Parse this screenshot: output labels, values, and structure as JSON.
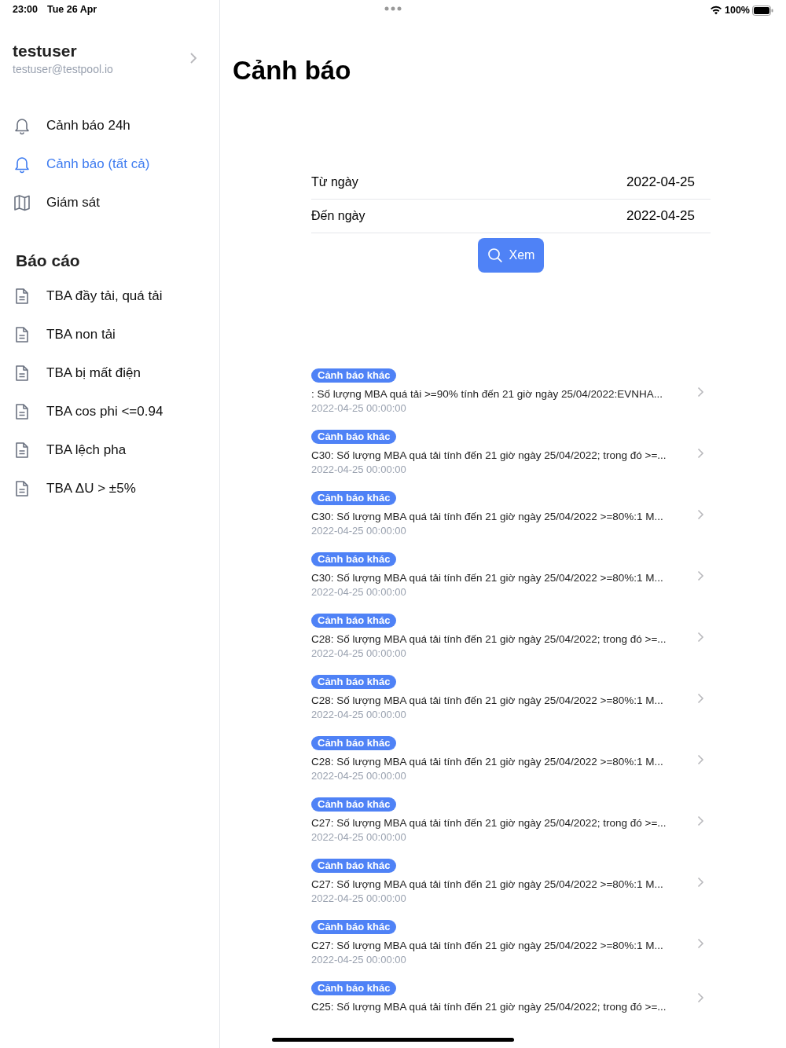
{
  "status_bar": {
    "time": "23:00",
    "date": "Tue 26 Apr",
    "battery": "100%"
  },
  "sidebar": {
    "user": {
      "name": "testuser",
      "email": "testuser@testpool.io"
    },
    "items": [
      {
        "kind": "bell",
        "label": "Cảnh báo 24h",
        "selected": false
      },
      {
        "kind": "bell",
        "label": "Cảnh báo (tất cả)",
        "selected": true
      },
      {
        "kind": "map",
        "label": "Giám sát",
        "selected": false
      }
    ],
    "reports": {
      "title": "Báo cáo",
      "items": [
        {
          "kind": "doc",
          "label": "TBA đầy tải, quá tải",
          "selected": false
        },
        {
          "kind": "doc",
          "label": "TBA non tải",
          "selected": false
        },
        {
          "kind": "doc",
          "label": "TBA bị mất điện",
          "selected": false
        },
        {
          "kind": "doc",
          "label": "TBA cos phi <=0.94",
          "selected": false
        },
        {
          "kind": "doc",
          "label": "TBA lệch pha",
          "selected": false
        },
        {
          "kind": "doc",
          "label": "TBA ΔU > ±5%",
          "selected": false
        }
      ]
    }
  },
  "title": "Cảnh báo",
  "filters": [
    {
      "label": "Từ ngày",
      "value": "2022-04-25"
    },
    {
      "label": "Đến ngày",
      "value": "2022-04-25"
    }
  ],
  "search_button": "Xem",
  "alerts": [
    {
      "tag": "Cảnh báo khác",
      "text": ": Số lượng MBA quá tải >=90% tính đến 21 giờ ngày 25/04/2022:EVNHA...",
      "time": "2022-04-25 00:00:00"
    },
    {
      "tag": "Cảnh báo khác",
      "text": "C30: Số lượng MBA quá tải tính đến 21 giờ ngày 25/04/2022; trong đó >=...",
      "time": "2022-04-25 00:00:00"
    },
    {
      "tag": "Cảnh báo khác",
      "text": "C30: Số lượng MBA quá tải tính đến 21 giờ ngày 25/04/2022 >=80%:1 M...",
      "time": "2022-04-25 00:00:00"
    },
    {
      "tag": "Cảnh báo khác",
      "text": "C30: Số lượng MBA quá tải tính đến 21 giờ ngày 25/04/2022 >=80%:1 M...",
      "time": "2022-04-25 00:00:00"
    },
    {
      "tag": "Cảnh báo khác",
      "text": "C28: Số lượng MBA quá tải tính đến 21 giờ ngày 25/04/2022; trong đó >=...",
      "time": "2022-04-25 00:00:00"
    },
    {
      "tag": "Cảnh báo khác",
      "text": "C28: Số lượng MBA quá tải tính đến 21 giờ ngày 25/04/2022 >=80%:1 M...",
      "time": "2022-04-25 00:00:00"
    },
    {
      "tag": "Cảnh báo khác",
      "text": "C28: Số lượng MBA quá tải tính đến 21 giờ ngày 25/04/2022 >=80%:1 M...",
      "time": "2022-04-25 00:00:00"
    },
    {
      "tag": "Cảnh báo khác",
      "text": "C27: Số lượng MBA quá tải tính đến 21 giờ ngày 25/04/2022; trong đó >=...",
      "time": "2022-04-25 00:00:00"
    },
    {
      "tag": "Cảnh báo khác",
      "text": "C27: Số lượng MBA quá tải tính đến 21 giờ ngày 25/04/2022 >=80%:1 M...",
      "time": "2022-04-25 00:00:00"
    },
    {
      "tag": "Cảnh báo khác",
      "text": "C27: Số lượng MBA quá tải tính đến 21 giờ ngày 25/04/2022 >=80%:1 M...",
      "time": "2022-04-25 00:00:00"
    },
    {
      "tag": "Cảnh báo khác",
      "text": "C25: Số lượng MBA quá tải tính đến 21 giờ ngày 25/04/2022; trong đó >=..."
    }
  ]
}
